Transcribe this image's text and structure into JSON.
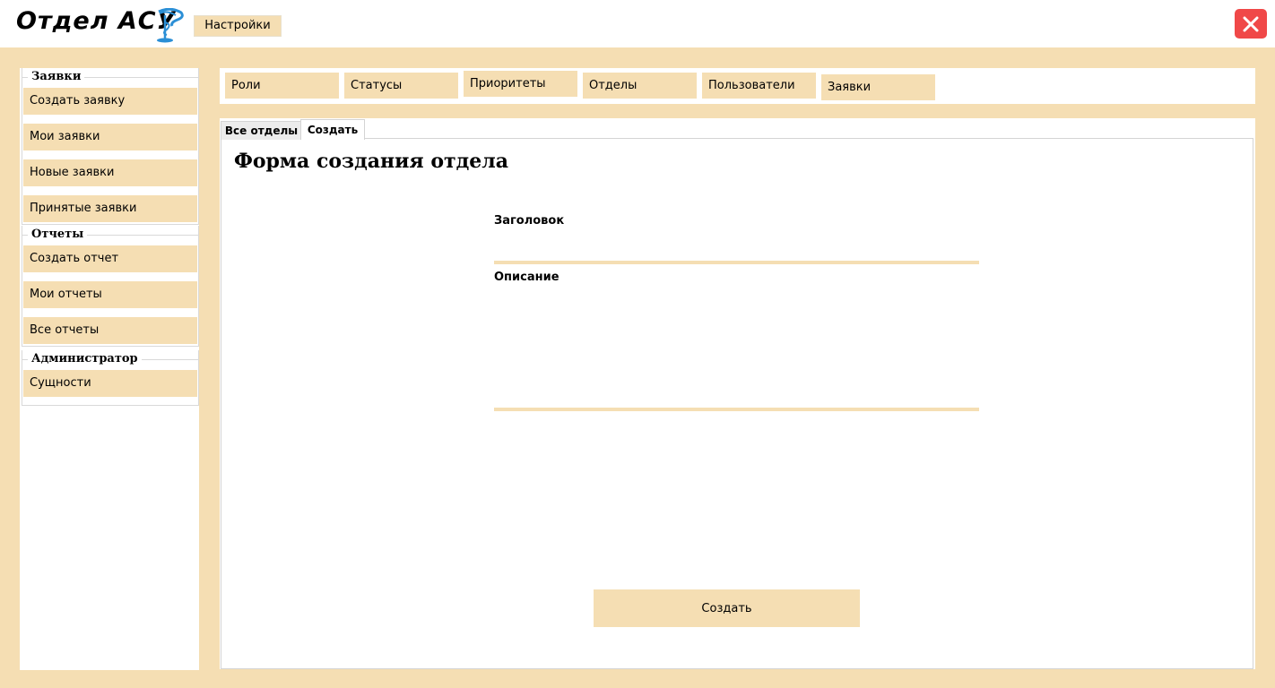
{
  "header": {
    "app_title": "Отдел АСУ",
    "logo_icon": "caduceus-cup-icon",
    "settings_label": "Настройки",
    "close_icon": "close-icon"
  },
  "colors": {
    "accent": "#f5deb3",
    "close": "#f04848",
    "logo": "#2b8fd6"
  },
  "sidebar": {
    "groups": [
      {
        "title": "Заявки",
        "items": [
          "Создать заявку",
          "Мои заявки",
          "Новые заявки",
          "Принятые заявки"
        ]
      },
      {
        "title": "Отчеты",
        "items": [
          "Создать отчет",
          "Мои отчеты",
          "Все отчеты"
        ]
      },
      {
        "title": "Администратор",
        "items": [
          "Сущности"
        ]
      }
    ]
  },
  "topnav": {
    "items": [
      "Роли",
      "Статусы",
      "Приоритеты",
      "Отделы",
      "Пользователи",
      "Заявки"
    ]
  },
  "tabs": [
    "Все отделы",
    "Создать"
  ],
  "form": {
    "title": "Форма создания отдела",
    "field_title_label": "Заголовок",
    "field_title_value": "",
    "field_desc_label": "Описание",
    "field_desc_value": "",
    "submit_label": "Создать"
  }
}
